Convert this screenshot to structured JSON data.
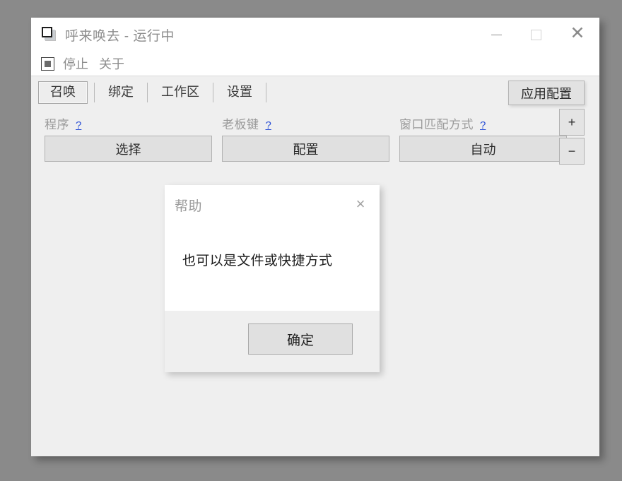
{
  "window": {
    "title": "呼来唤去 - 运行中",
    "icon": "window-stack-icon",
    "controls": {
      "minimize": "minimize-icon",
      "maximize": "maximize-icon",
      "close": "close-icon"
    }
  },
  "menubar": {
    "stop_icon": "stop-square-icon",
    "items": [
      {
        "label": "停止"
      },
      {
        "label": "关于"
      }
    ]
  },
  "tabs": [
    {
      "label": "召唤",
      "active": true
    },
    {
      "label": "绑定",
      "active": false
    },
    {
      "label": "工作区",
      "active": false
    },
    {
      "label": "设置",
      "active": false
    }
  ],
  "toolbar": {
    "apply_label": "应用配置"
  },
  "config_fields": [
    {
      "label": "程序",
      "help": "?",
      "value": "选择"
    },
    {
      "label": "老板键",
      "help": "?",
      "value": "配置"
    },
    {
      "label": "窗口匹配方式",
      "help": "?",
      "value": "自动"
    }
  ],
  "stepper": {
    "add_label": "+",
    "remove_label": "−"
  },
  "dialog": {
    "title": "帮助",
    "close": "×",
    "message": "也可以是文件或快捷方式",
    "ok_label": "确定"
  },
  "colors": {
    "desktop": "#8a8a8a",
    "window_bg": "#efefef",
    "titlebar_bg": "#ffffff",
    "button_bg": "#e0e0e0",
    "button_border": "#b2b2b2",
    "link": "#2a4fd6",
    "muted_text": "#9a9a9a",
    "body_text": "#1b1b1b"
  }
}
